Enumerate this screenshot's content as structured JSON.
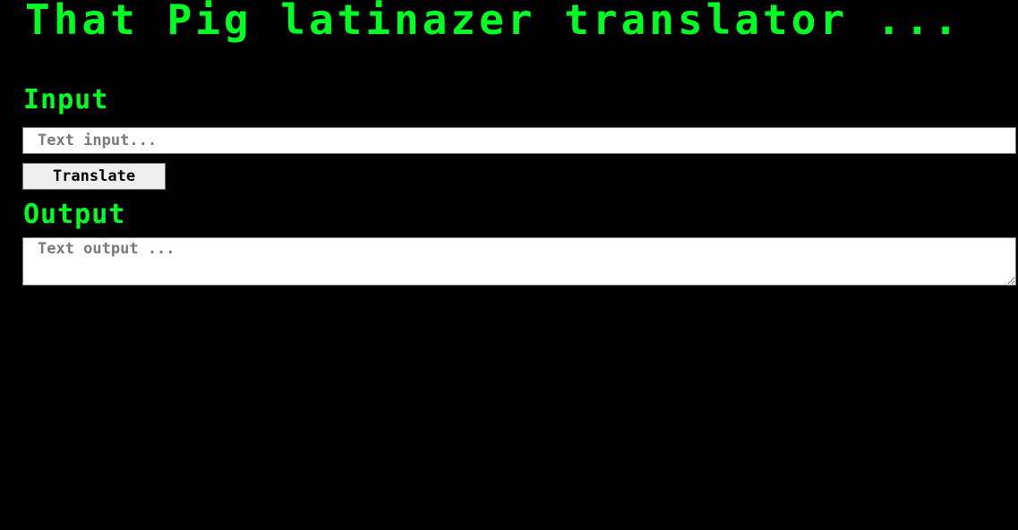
{
  "page": {
    "title": "That Pig latinazer translator ..."
  },
  "input_section": {
    "heading": "Input",
    "placeholder": "Text input...",
    "value": ""
  },
  "translate_button": {
    "label": "Translate"
  },
  "output_section": {
    "heading": "Output",
    "placeholder": "Text output ...",
    "value": ""
  },
  "colors": {
    "background": "#000000",
    "accent_text": "#00ff22",
    "field_background": "#ffffff",
    "button_background": "#efefef",
    "placeholder_text": "#7a7a7a"
  }
}
